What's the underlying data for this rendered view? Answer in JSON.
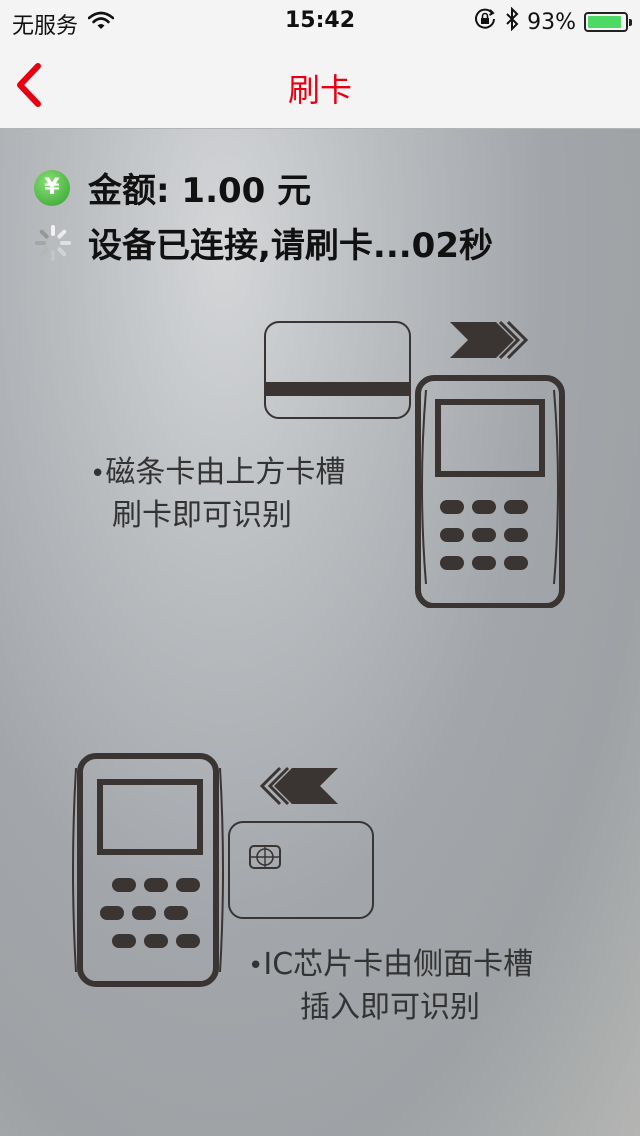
{
  "status_bar": {
    "carrier": "无服务",
    "time": "15:42",
    "battery_percent": "93%",
    "battery_level": 0.93,
    "icons": [
      "wifi-icon",
      "orientation-lock-icon",
      "bluetooth-icon",
      "battery-icon"
    ]
  },
  "nav": {
    "title": "刷卡",
    "back_icon": "chevron-left-icon"
  },
  "info": {
    "amount_label": "金额: 1.00 元",
    "status_text": "设备已连接,请刷卡...02秒"
  },
  "instructions": {
    "magnetic_bullet": "•",
    "magnetic_line1": "磁条卡由上方卡槽",
    "magnetic_line2": "刷卡即可识别",
    "ic_bullet": "•",
    "ic_line1": "IC芯片卡由侧面卡槽",
    "ic_line2": "插入即可识别"
  },
  "colors": {
    "accent": "#e60012",
    "yen_badge": "#3aa935"
  }
}
